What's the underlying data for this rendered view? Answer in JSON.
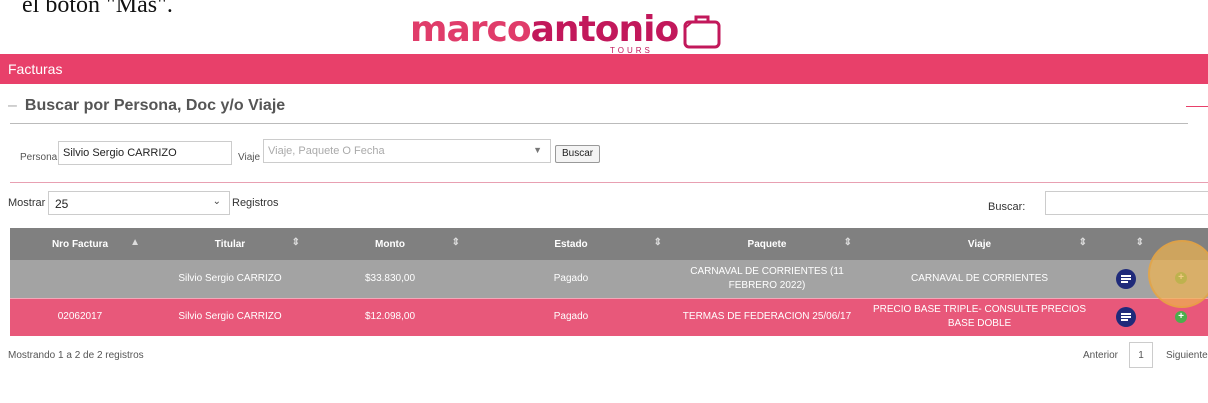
{
  "caption": "el botón \"Más\".",
  "logo": {
    "part1": "marco",
    "part2": "antonio",
    "tag": "TOURS"
  },
  "header": {
    "title": "Facturas"
  },
  "search": {
    "heading": "Buscar por Persona, Doc y/o Viaje",
    "persona_label": "Persona",
    "persona_value": "Silvio Sergio CARRIZO",
    "viaje_label": "Viaje",
    "viaje_placeholder": "Viaje, Paquete O Fecha",
    "button": "Buscar"
  },
  "length": {
    "mostrar": "Mostrar",
    "value": "25",
    "registros": "Registros"
  },
  "filter": {
    "label": "Buscar:",
    "value": ""
  },
  "table": {
    "columns": [
      "Nro Factura",
      "Titular",
      "Monto",
      "Estado",
      "Paquete",
      "Viaje",
      ""
    ],
    "rows": [
      {
        "nro": "",
        "titular": "Silvio Sergio CARRIZO",
        "monto": "$33.830,00",
        "estado": "Pagado",
        "paquete": "CARNAVAL DE CORRIENTES (11 FEBRERO 2022)",
        "viaje": "CARNAVAL DE CORRIENTES"
      },
      {
        "nro": "02062017",
        "titular": "Silvio Sergio CARRIZO",
        "monto": "$12.098,00",
        "estado": "Pagado",
        "paquete": "TERMAS DE FEDERACION 25/06/17",
        "viaje": "PRECIO BASE TRIPLE- CONSULTE PRECIOS BASE DOBLE"
      }
    ]
  },
  "footer": {
    "info": "Mostrando 1 a 2 de 2 registros",
    "prev": "Anterior",
    "page": "1",
    "next": "Siguiente"
  },
  "icons": {
    "doc": "document-list-icon",
    "more": "plus-circle-icon"
  },
  "colors": {
    "accent": "#e8406a",
    "header_gray": "#808080",
    "row_gray": "#a3a3a3",
    "row_pink": "#e8587a",
    "doc_icon": "#1f2a7a",
    "plus_icon": "#4cae4c"
  }
}
